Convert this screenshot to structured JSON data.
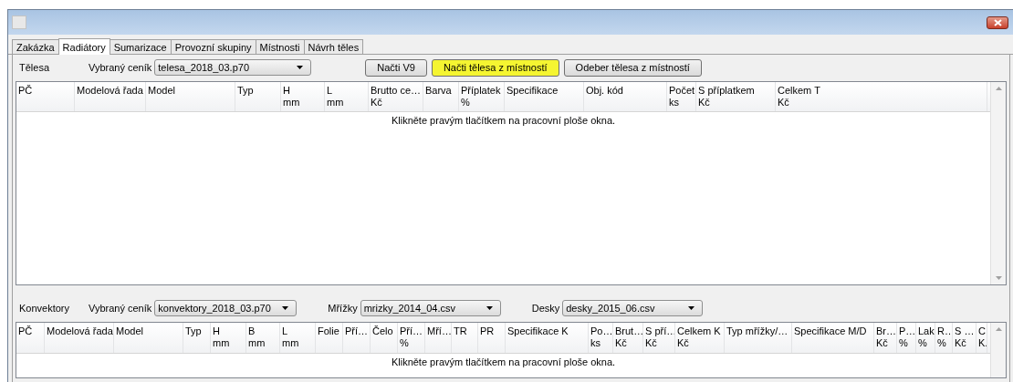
{
  "tabs": [
    {
      "label": "Zakázka",
      "selected": false
    },
    {
      "label": "Radiátory",
      "selected": true
    },
    {
      "label": "Sumarizace",
      "selected": false
    },
    {
      "label": "Provozní skupiny",
      "selected": false
    },
    {
      "label": "Místnosti",
      "selected": false
    },
    {
      "label": "Návrh těles",
      "selected": false
    }
  ],
  "radiators": {
    "section_label": "Tělesa",
    "pricelist_label": "Vybraný ceník",
    "pricelist_value": "telesa_2018_03.p70",
    "buttons": [
      {
        "label": "Načti V9",
        "highlighted": false
      },
      {
        "label": "Načti tělesa z místností",
        "highlighted": true
      },
      {
        "label": "Odeber tělesa z místností",
        "highlighted": false
      }
    ],
    "table": {
      "columns": [
        {
          "label": "PČ"
        },
        {
          "label": "Modelová řada"
        },
        {
          "label": "Model"
        },
        {
          "label": "Typ"
        },
        {
          "label": "H",
          "unit": "mm"
        },
        {
          "label": "L",
          "unit": "mm"
        },
        {
          "label": "Brutto ce…",
          "unit": "Kč"
        },
        {
          "label": "Barva"
        },
        {
          "label": "Příplatek",
          "unit": "%"
        },
        {
          "label": "Specifikace"
        },
        {
          "label": "Obj. kód"
        },
        {
          "label": "Počet",
          "unit": "ks"
        },
        {
          "label": "S příplatkem",
          "unit": "Kč"
        },
        {
          "label": "Celkem T",
          "unit": "Kč"
        }
      ],
      "empty_message": "Klikněte pravým tlačítkem na pracovní ploše okna."
    }
  },
  "convectors": {
    "section_label": "Konvektory",
    "pricelist_label": "Vybraný ceník",
    "pricelist_value": "konvektory_2018_03.p70",
    "grilles_label": "Mřížky",
    "grilles_value": "mrizky_2014_04.csv",
    "boards_label": "Desky",
    "boards_value": "desky_2015_06.csv",
    "table": {
      "columns": [
        {
          "label": "PČ"
        },
        {
          "label": "Modelová řada"
        },
        {
          "label": "Model"
        },
        {
          "label": "Typ"
        },
        {
          "label": "H",
          "unit": "mm"
        },
        {
          "label": "B",
          "unit": "mm"
        },
        {
          "label": "L",
          "unit": "mm"
        },
        {
          "label": "Folie"
        },
        {
          "label": "Pří…"
        },
        {
          "label": "Čelo"
        },
        {
          "label": "Pří…",
          "unit": "%"
        },
        {
          "label": "Mří…"
        },
        {
          "label": "TR"
        },
        {
          "label": "PR"
        },
        {
          "label": "Specifikace K"
        },
        {
          "label": "Po…",
          "unit": "ks"
        },
        {
          "label": "Brut…",
          "unit": "Kč"
        },
        {
          "label": "S pří…",
          "unit": "Kč"
        },
        {
          "label": "Celkem K",
          "unit": "Kč"
        },
        {
          "label": "Typ mřížky/…"
        },
        {
          "label": "Specifikace M/D"
        },
        {
          "label": "Br…",
          "unit": "Kč"
        },
        {
          "label": "P…",
          "unit": "%"
        },
        {
          "label": "Lak",
          "unit": "%"
        },
        {
          "label": "R…",
          "unit": "%"
        },
        {
          "label": "S …",
          "unit": "Kč"
        },
        {
          "label": "C.",
          "unit": "K."
        }
      ],
      "empty_message": "Klikněte pravým tlačítkem na pracovní ploše okna."
    }
  }
}
